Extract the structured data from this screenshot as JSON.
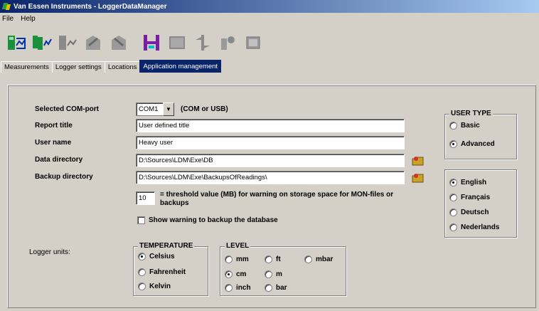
{
  "window": {
    "title": "Van Essen Instruments - LoggerDataManager"
  },
  "menu": [
    "File",
    "Help"
  ],
  "toolbar": {
    "icons": [
      "measure-read-icon",
      "measure-multi-icon",
      "measure-chart-icon",
      "export-icon",
      "import-icon",
      "h-icon",
      "blank-icon",
      "transfer-icon",
      "program-icon",
      "logger-icon"
    ]
  },
  "tabs": [
    "Measurements",
    "Logger settings",
    "Locations",
    "Application management"
  ],
  "active_tab": "Application management",
  "form": {
    "com_port_label": "Selected COM-port",
    "com_port_value": "COM1",
    "com_port_hint": "(COM or USB)",
    "report_title_label": "Report title",
    "report_title_value": "User defined title",
    "user_name_label": "User name",
    "user_name_value": "Heavy user",
    "data_dir_label": "Data directory",
    "data_dir_value": "D:\\Sources\\LDM\\Exe\\DB",
    "backup_dir_label": "Backup directory",
    "backup_dir_value": "D:\\Sources\\LDM\\Exe\\BackupsOfReadings\\",
    "threshold_value": "10",
    "threshold_text": "= threshold value (MB) for warning on storage space for MON-files or backups",
    "show_warning_label": "Show warning to backup the database",
    "logger_units_label": "Logger units:"
  },
  "temperature": {
    "title": "TEMPERATURE",
    "options": [
      "Celsius",
      "Fahrenheit",
      "Kelvin"
    ],
    "selected": "Celsius"
  },
  "level": {
    "title": "LEVEL",
    "options": [
      "mm",
      "ft",
      "mbar",
      "cm",
      "m",
      "inch",
      "bar"
    ],
    "selected": "cm"
  },
  "user_type": {
    "title": "USER TYPE",
    "options": [
      "Basic",
      "Advanced"
    ],
    "selected": "Advanced"
  },
  "language": {
    "options": [
      "English",
      "Français",
      "Deutsch",
      "Nederlands"
    ],
    "selected": "English"
  }
}
